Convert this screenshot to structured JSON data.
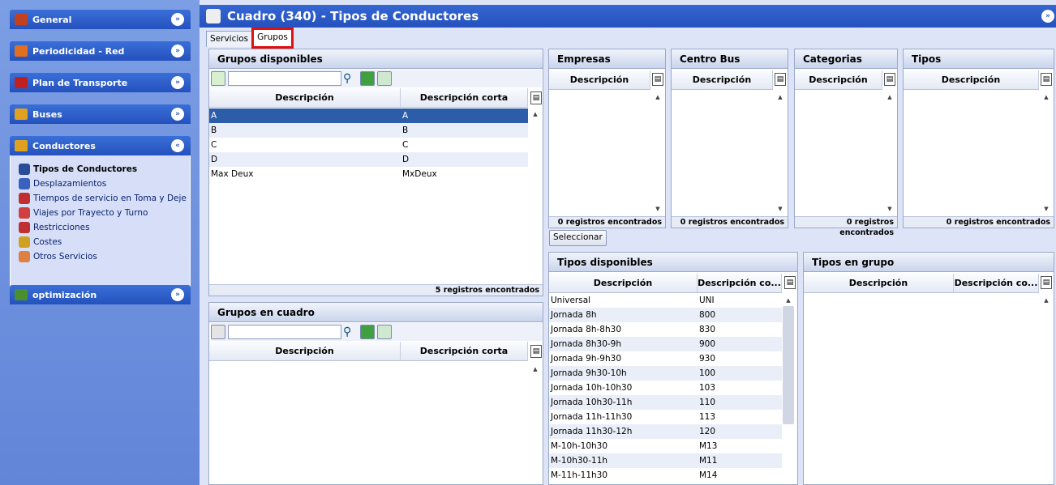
{
  "sidebar": {
    "panels": [
      {
        "label": "General",
        "color": "#c04020"
      },
      {
        "label": "Periodicidad - Red",
        "color": "#e07020"
      },
      {
        "label": "Plan de Transporte",
        "color": "#c02020"
      },
      {
        "label": "Buses",
        "color": "#e0a020"
      },
      {
        "label": "Conductores",
        "color": "#e0a020"
      },
      {
        "label": "optimización",
        "color": "#4a9030"
      }
    ],
    "conductores_items": [
      {
        "label": "Tipos de Conductores"
      },
      {
        "label": "Desplazamientos"
      },
      {
        "label": "Tiempos de servicio en Toma y Deje"
      },
      {
        "label": "Viajes por Trayecto y Turno"
      },
      {
        "label": "Restricciones"
      },
      {
        "label": "Costes"
      },
      {
        "label": "Otros Servicios"
      }
    ]
  },
  "title": "Cuadro (340) - Tipos de Conductores",
  "tabs": [
    "Servicios",
    "Grupos"
  ],
  "grupos_disponibles": {
    "title": "Grupos disponibles",
    "col1": "Descripción",
    "col2": "Descripción corta",
    "rows": [
      {
        "desc": "A",
        "short": "A"
      },
      {
        "desc": "B",
        "short": "B"
      },
      {
        "desc": "C",
        "short": "C"
      },
      {
        "desc": "D",
        "short": "D"
      },
      {
        "desc": "Max Deux",
        "short": "MxDeux"
      }
    ],
    "status": "5 registros encontrados"
  },
  "grupos_en_cuadro": {
    "title": "Grupos en cuadro",
    "col1": "Descripción",
    "col2": "Descripción corta"
  },
  "empresas": {
    "title": "Empresas",
    "col": "Descripción",
    "status": "0 registros encontrados"
  },
  "centro_bus": {
    "title": "Centro Bus",
    "col": "Descripción",
    "status": "0 registros encontrados"
  },
  "categorias": {
    "title": "Categorias",
    "col": "Descripción",
    "status": "0 registros encontrados"
  },
  "tipos": {
    "title": "Tipos",
    "col": "Descripción",
    "status": "0 registros encontrados"
  },
  "seleccionar_label": "Seleccionar",
  "tipos_disponibles": {
    "title": "Tipos disponibles",
    "col1": "Descripción",
    "col2": "Descripción co...",
    "rows": [
      {
        "desc": "Universal",
        "short": "UNI"
      },
      {
        "desc": "Jornada 8h",
        "short": "800"
      },
      {
        "desc": "Jornada 8h-8h30",
        "short": "830"
      },
      {
        "desc": "Jornada 8h30-9h",
        "short": "900"
      },
      {
        "desc": "Jornada 9h-9h30",
        "short": "930"
      },
      {
        "desc": "Jornada 9h30-10h",
        "short": "100"
      },
      {
        "desc": "Jornada 10h-10h30",
        "short": "103"
      },
      {
        "desc": "Jornada 10h30-11h",
        "short": "110"
      },
      {
        "desc": "Jornada 11h-11h30",
        "short": "113"
      },
      {
        "desc": "Jornada 11h30-12h",
        "short": "120"
      },
      {
        "desc": "M-10h-10h30",
        "short": "M13"
      },
      {
        "desc": "M-10h30-11h",
        "short": "M11"
      },
      {
        "desc": "M-11h-11h30",
        "short": "M14"
      }
    ]
  },
  "tipos_en_grupo": {
    "title": "Tipos en grupo",
    "col1": "Descripción",
    "col2": "Descripción co..."
  }
}
